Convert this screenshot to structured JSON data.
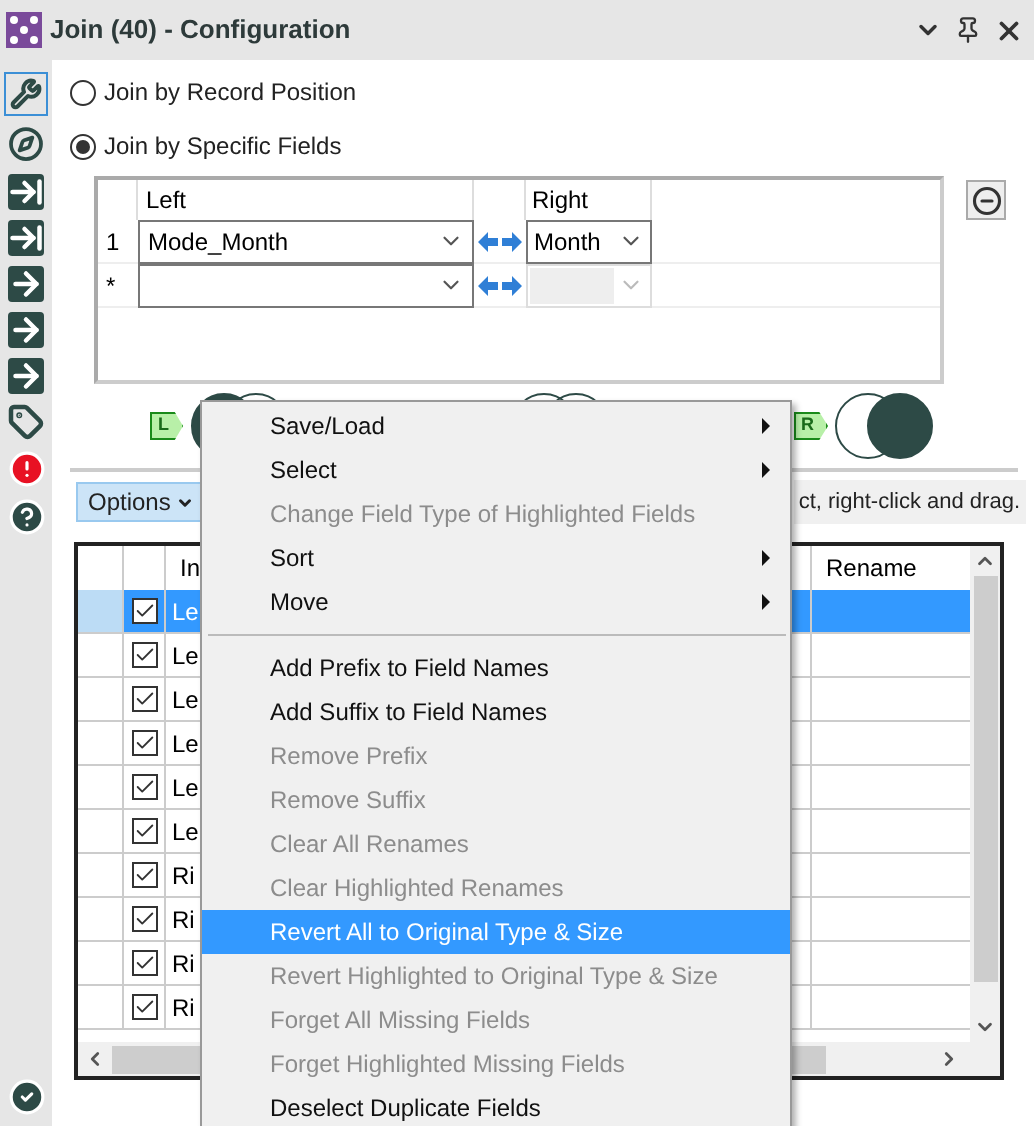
{
  "window": {
    "title": "Join (40) - Configuration"
  },
  "join_modes": [
    {
      "label": "Join by Record Position",
      "selected": false
    },
    {
      "label": "Join by Specific Fields",
      "selected": true
    }
  ],
  "join_fields": {
    "columns": [
      "Left",
      "Right"
    ],
    "rows": [
      {
        "index": "1",
        "left": "Mode_Month",
        "right": "Month",
        "disabled": false
      },
      {
        "index": "*",
        "disabled": true
      }
    ]
  },
  "venn": {
    "left_tag": "L",
    "right_tag": "R"
  },
  "options": {
    "label": "Options",
    "hint": "ct, right-click and drag."
  },
  "table": {
    "columns": [
      "In",
      "Rename"
    ],
    "rows": [
      {
        "cell": "Le",
        "checked": true,
        "selected": true
      },
      {
        "cell": "Le",
        "checked": true,
        "selected": false
      },
      {
        "cell": "Le",
        "checked": true,
        "selected": false
      },
      {
        "cell": "Le",
        "checked": true,
        "selected": false
      },
      {
        "cell": "Le",
        "checked": true,
        "selected": false
      },
      {
        "cell": "Le",
        "checked": true,
        "selected": false
      },
      {
        "cell": "Ri",
        "checked": true,
        "selected": false
      },
      {
        "cell": "Ri",
        "checked": true,
        "selected": false
      },
      {
        "cell": "Ri",
        "checked": true,
        "selected": false
      },
      {
        "cell": "Ri",
        "checked": true,
        "selected": false
      }
    ]
  },
  "context_menu": {
    "items": [
      {
        "kind": "submenu",
        "label": "Save/Load",
        "disabled": false,
        "selected": false
      },
      {
        "kind": "submenu",
        "label": "Select",
        "disabled": false,
        "selected": false
      },
      {
        "kind": "item",
        "label": "Change Field Type of Highlighted Fields",
        "disabled": true,
        "selected": false
      },
      {
        "kind": "submenu",
        "label": "Sort",
        "disabled": false,
        "selected": false
      },
      {
        "kind": "submenu",
        "label": "Move",
        "disabled": false,
        "selected": false
      },
      {
        "kind": "separator"
      },
      {
        "kind": "item",
        "label": "Add Prefix to Field Names",
        "disabled": false,
        "selected": false
      },
      {
        "kind": "item",
        "label": "Add Suffix to Field Names",
        "disabled": false,
        "selected": false
      },
      {
        "kind": "item",
        "label": "Remove Prefix",
        "disabled": true,
        "selected": false
      },
      {
        "kind": "item",
        "label": "Remove Suffix",
        "disabled": true,
        "selected": false
      },
      {
        "kind": "item",
        "label": "Clear All Renames",
        "disabled": true,
        "selected": false
      },
      {
        "kind": "item",
        "label": "Clear Highlighted Renames",
        "disabled": true,
        "selected": false
      },
      {
        "kind": "item",
        "label": "Revert All to Original Type & Size",
        "disabled": false,
        "selected": true
      },
      {
        "kind": "item",
        "label": "Revert Highlighted to Original Type & Size",
        "disabled": true,
        "selected": false
      },
      {
        "kind": "item",
        "label": "Forget All Missing Fields",
        "disabled": true,
        "selected": false
      },
      {
        "kind": "item",
        "label": "Forget Highlighted Missing Fields",
        "disabled": true,
        "selected": false
      },
      {
        "kind": "item",
        "label": "Deselect Duplicate Fields",
        "disabled": false,
        "selected": false
      }
    ]
  }
}
